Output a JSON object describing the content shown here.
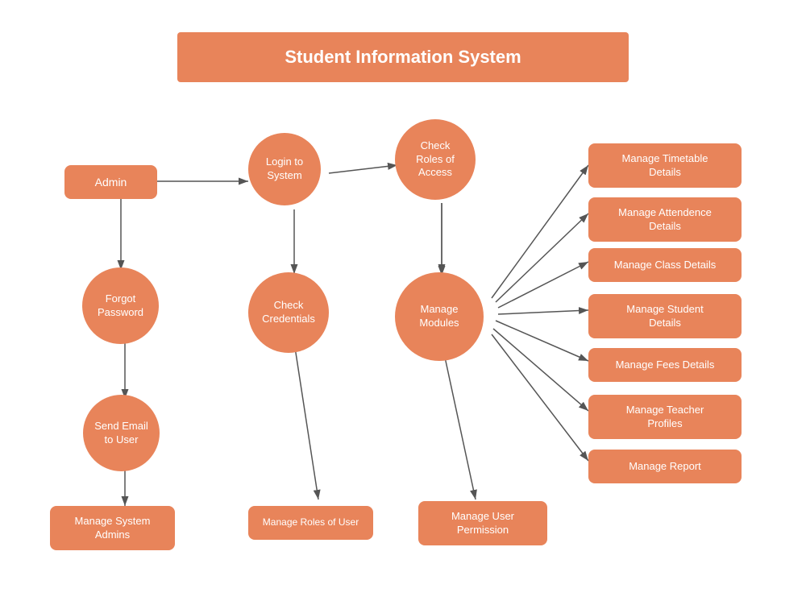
{
  "title": "Student Information System",
  "nodes": {
    "admin": "Admin",
    "login": "Login to\nSystem",
    "check_roles": "Check\nRoles of\nAccess",
    "forgot_password": "Forgot\nPassword",
    "check_credentials": "Check\nCredentials",
    "manage_modules": "Manage\nModules",
    "send_email": "Send Email\nto User",
    "manage_system_admins": "Manage System\nAdmins",
    "manage_roles_user": "Manage Roles of User",
    "manage_user_permission": "Manage User\nPermission",
    "manage_timetable": "Manage Timetable\nDetails",
    "manage_attendance": "Manage Attendence\nDetails",
    "manage_class": "Manage Class Details",
    "manage_student": "Manage Student\nDetails",
    "manage_fees": "Manage Fees Details",
    "manage_teacher": "Manage Teacher\nProfiles",
    "manage_report": "Manage Report"
  }
}
